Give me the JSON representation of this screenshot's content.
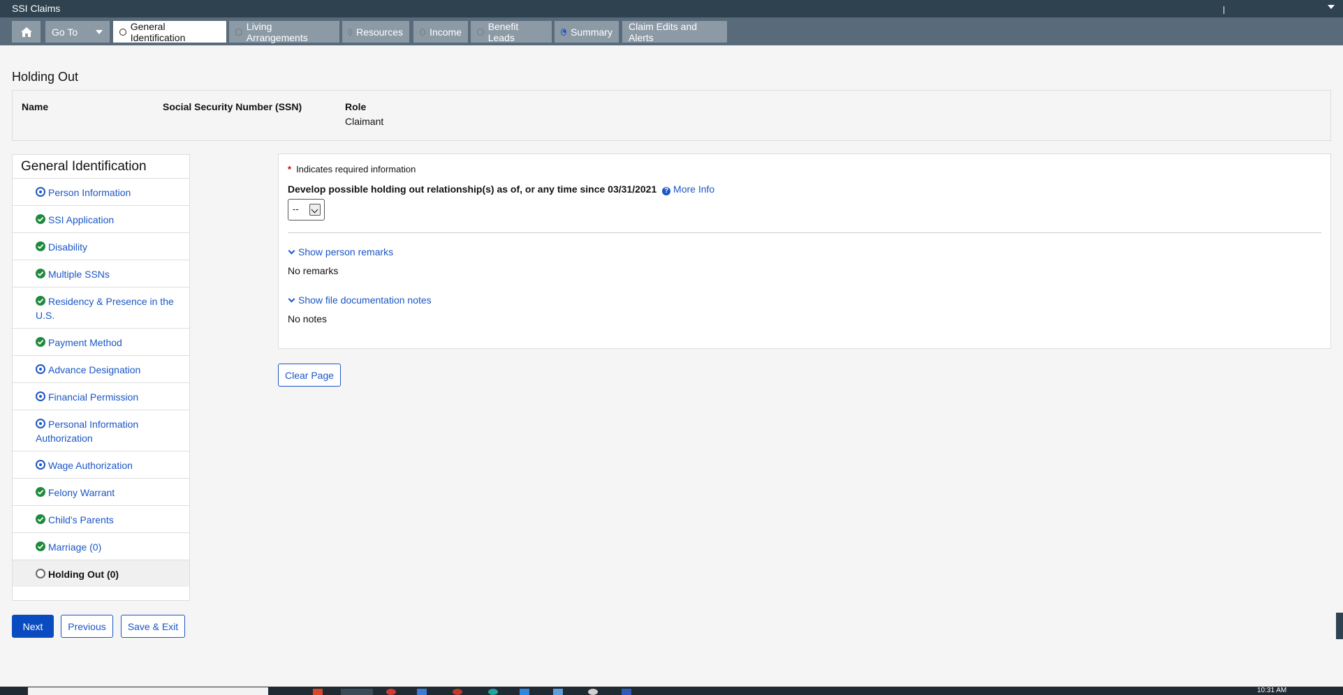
{
  "app": {
    "title": "SSI Claims"
  },
  "nav": {
    "goto_label": "Go To",
    "tabs": [
      {
        "label": "General Identification",
        "state": "active"
      },
      {
        "label": "Living Arrangements",
        "state": "empty"
      },
      {
        "label": "Resources",
        "state": "empty"
      },
      {
        "label": "Income",
        "state": "empty"
      },
      {
        "label": "Benefit Leads",
        "state": "empty"
      },
      {
        "label": "Summary",
        "state": "in-progress"
      },
      {
        "label": "Claim Edits and Alerts",
        "state": "none"
      }
    ]
  },
  "page": {
    "title": "Holding Out"
  },
  "person": {
    "name_label": "Name",
    "ssn_label": "Social Security Number (SSN)",
    "role_label": "Role",
    "role_value": "Claimant"
  },
  "sidebar": {
    "heading": "General Identification",
    "items": [
      {
        "label": "Person Information",
        "status": "in-progress"
      },
      {
        "label": "SSI Application",
        "status": "complete"
      },
      {
        "label": "Disability",
        "status": "complete"
      },
      {
        "label": "Multiple SSNs",
        "status": "complete"
      },
      {
        "label": "Residency & Presence in the U.S.",
        "status": "complete"
      },
      {
        "label": "Payment Method",
        "status": "complete"
      },
      {
        "label": "Advance Designation",
        "status": "in-progress"
      },
      {
        "label": "Financial Permission",
        "status": "in-progress"
      },
      {
        "label": "Personal Information Authorization",
        "status": "in-progress"
      },
      {
        "label": "Wage Authorization",
        "status": "in-progress"
      },
      {
        "label": "Felony Warrant",
        "status": "complete"
      },
      {
        "label": "Child's Parents",
        "status": "complete"
      },
      {
        "label": "Marriage (0)",
        "status": "complete"
      },
      {
        "label": "Holding Out (0)",
        "status": "current"
      }
    ]
  },
  "form": {
    "required_star": "*",
    "required_note": "Indicates required information",
    "question": "Develop possible holding out relationship(s) as of, or any time since 03/31/2021",
    "help_glyph": "?",
    "more_info": "More Info",
    "select_value": "--",
    "show_remarks": "Show person remarks",
    "remarks_value": "No remarks",
    "show_notes": "Show file documentation notes",
    "notes_value": "No notes",
    "clear_page": "Clear Page"
  },
  "footer": {
    "next": "Next",
    "previous": "Previous",
    "save_exit": "Save & Exit"
  },
  "taskbar": {
    "clock": "10:31 AM"
  },
  "colors": {
    "link": "#1a56c4",
    "complete": "#1e8a3c",
    "header": "#2e4250",
    "navbar": "#596b7b"
  }
}
